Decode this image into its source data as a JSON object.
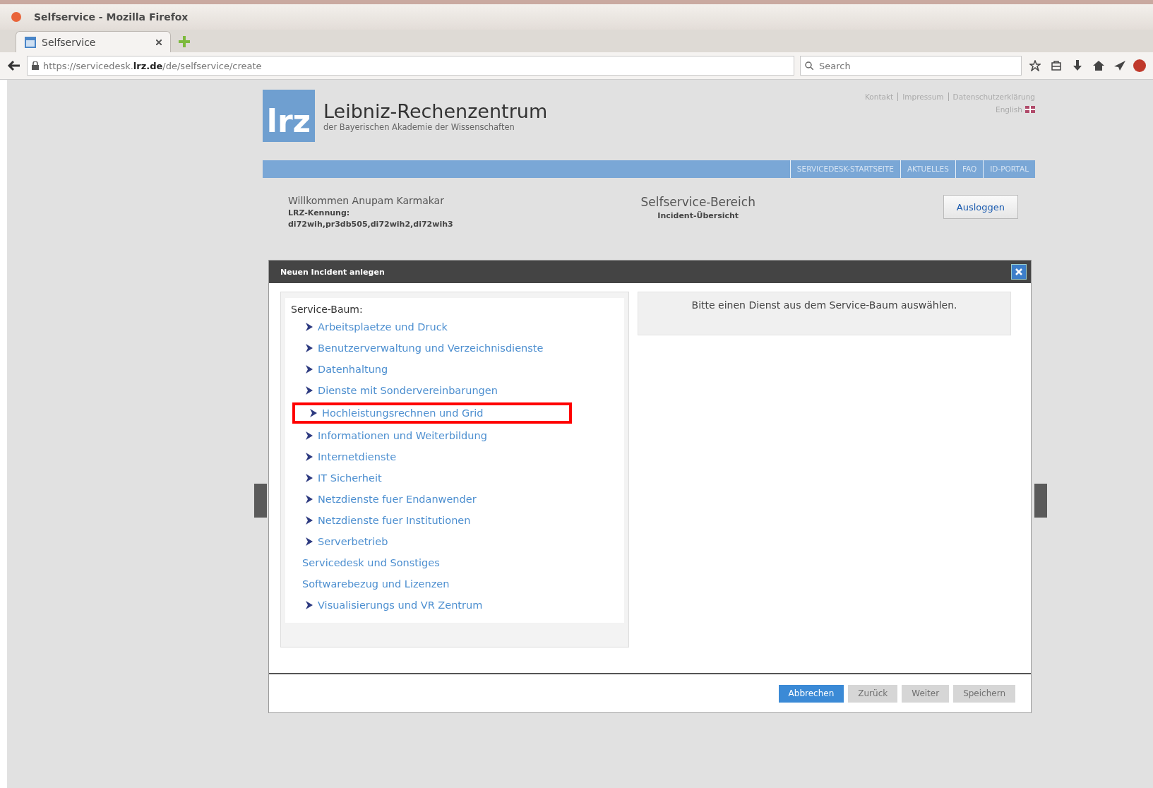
{
  "window": {
    "title": "Selfservice - Mozilla Firefox"
  },
  "tabs": [
    {
      "label": "Selfservice",
      "selected": true
    }
  ],
  "address_bar": {
    "url_prefix": "https://servicedesk.",
    "url_domain": "lrz.de",
    "url_path": "/de/selfservice/create"
  },
  "search": {
    "placeholder": "Search"
  },
  "header": {
    "logo": "lrz",
    "title": "Leibniz-Rechenzentrum",
    "subtitle": "der Bayerischen Akademie der Wissenschaften",
    "top_links": [
      "Kontakt",
      "Impressum",
      "Datenschutzerklärung"
    ],
    "language": "English"
  },
  "nav": [
    "SERVICEDESK-STARTSEITE",
    "AKTUELLES",
    "FAQ",
    "ID-PORTAL"
  ],
  "user": {
    "welcome": "Willkommen Anupam Karmakar",
    "id_label": "LRZ-Kennung:",
    "ids": "di72wih,pr3db505,di72wih2,di72wih3"
  },
  "section": {
    "title": "Selfservice-Bereich",
    "subtitle": "Incident-Übersicht"
  },
  "logout": "Ausloggen",
  "dialog": {
    "title": "Neuen Incident anlegen",
    "tree_label": "Service-Baum:",
    "tree": [
      {
        "label": "Arbeitsplaetze und Druck",
        "expandable": true,
        "highlighted": false
      },
      {
        "label": "Benutzerverwaltung und Verzeichnisdienste",
        "expandable": true,
        "highlighted": false
      },
      {
        "label": "Datenhaltung",
        "expandable": true,
        "highlighted": false
      },
      {
        "label": "Dienste mit Sondervereinbarungen",
        "expandable": true,
        "highlighted": false
      },
      {
        "label": "Hochleistungsrechnen und Grid",
        "expandable": true,
        "highlighted": true
      },
      {
        "label": "Informationen und Weiterbildung",
        "expandable": true,
        "highlighted": false
      },
      {
        "label": "Internetdienste",
        "expandable": true,
        "highlighted": false
      },
      {
        "label": "IT Sicherheit",
        "expandable": true,
        "highlighted": false
      },
      {
        "label": "Netzdienste fuer Endanwender",
        "expandable": true,
        "highlighted": false
      },
      {
        "label": "Netzdienste fuer Institutionen",
        "expandable": true,
        "highlighted": false
      },
      {
        "label": "Serverbetrieb",
        "expandable": true,
        "highlighted": false
      },
      {
        "label": "Servicedesk und Sonstiges",
        "expandable": false,
        "highlighted": false
      },
      {
        "label": "Softwarebezug und Lizenzen",
        "expandable": false,
        "highlighted": false
      },
      {
        "label": "Visualisierungs und VR Zentrum",
        "expandable": true,
        "highlighted": false
      }
    ],
    "message": "Bitte einen Dienst aus dem Service-Baum auswählen.",
    "buttons": [
      {
        "label": "Abbrechen",
        "disabled": false
      },
      {
        "label": "Zurück",
        "disabled": true
      },
      {
        "label": "Weiter",
        "disabled": true
      },
      {
        "label": "Speichern",
        "disabled": true
      }
    ]
  }
}
